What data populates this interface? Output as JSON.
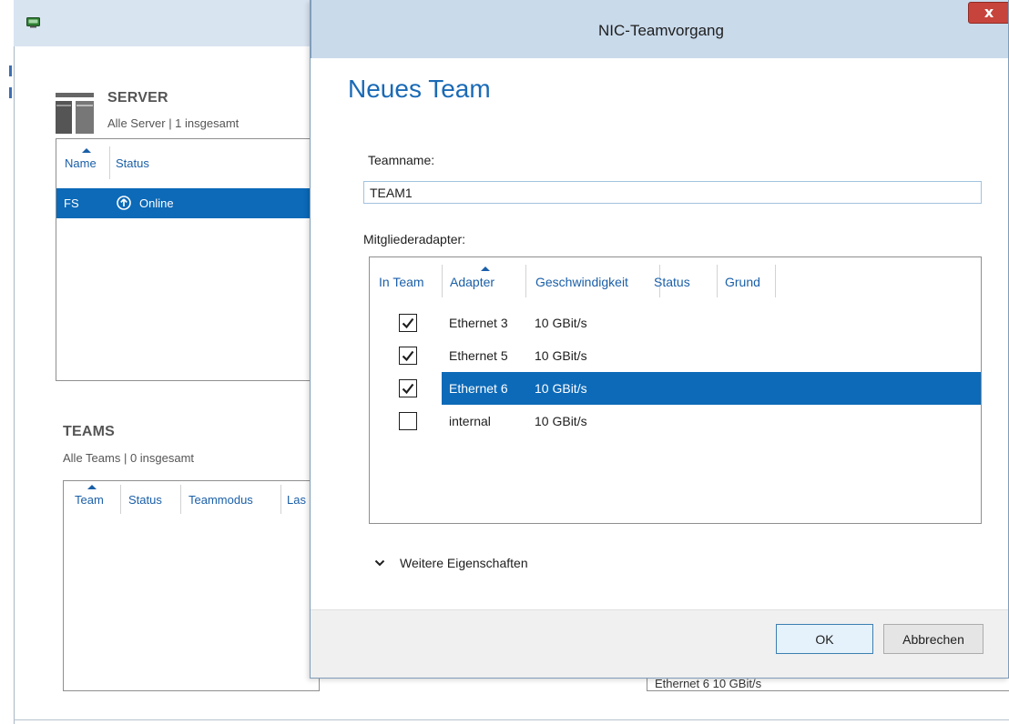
{
  "dialog": {
    "title": "NIC-Teamvorgang",
    "close_label": "x",
    "heading": "Neues Team",
    "teamname_label": "Teamname:",
    "teamname_value": "TEAM1",
    "members_label": "Mitgliederadapter:",
    "members_columns": [
      "In Team",
      "Adapter",
      "Geschwindigkeit",
      "Status",
      "Grund"
    ],
    "members": [
      {
        "in_team": true,
        "adapter": "Ethernet 3",
        "speed": "10 GBit/s",
        "selected": false
      },
      {
        "in_team": true,
        "adapter": "Ethernet 5",
        "speed": "10 GBit/s",
        "selected": false
      },
      {
        "in_team": true,
        "adapter": "Ethernet 6",
        "speed": "10 GBit/s",
        "selected": true
      },
      {
        "in_team": false,
        "adapter": "internal",
        "speed": "10 GBit/s",
        "selected": false
      }
    ],
    "more_properties_label": "Weitere Eigenschaften",
    "ok_label": "OK",
    "cancel_label": "Abbrechen"
  },
  "background": {
    "servers": {
      "title": "SERVER",
      "subtitle": "Alle Server | 1 insgesamt",
      "columns": [
        "Name",
        "Status"
      ],
      "rows": [
        {
          "name": "FS",
          "status": "Online",
          "selected": true
        }
      ]
    },
    "teams": {
      "title": "TEAMS",
      "subtitle": "Alle Teams | 0 insgesamt",
      "columns": [
        "Team",
        "Status",
        "Teammodus",
        "Las"
      ]
    },
    "adapter_panel_partial": "Ethernet 6   10 GBit/s"
  },
  "colors": {
    "accent": "#0c6ab8",
    "heading": "#1a6ab6",
    "titlebar": "#c9daeb",
    "close": "#c7443c"
  }
}
